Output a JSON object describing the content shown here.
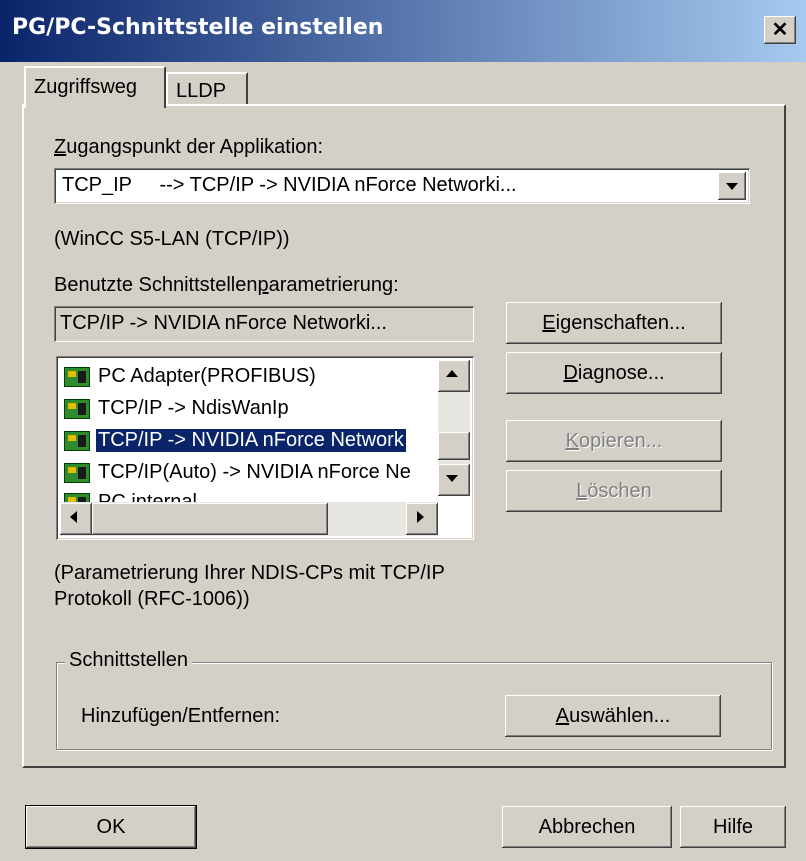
{
  "window": {
    "title": "PG/PC-Schnittstelle einstellen",
    "close_glyph": "✕"
  },
  "tabs": [
    {
      "label": "Zugriffsweg",
      "active": true
    },
    {
      "label": "LLDP",
      "active": false
    }
  ],
  "access_point": {
    "label_first": "Z",
    "label_rest": "ugangspunkt der Applikation:",
    "value": "TCP_IP     --> TCP/IP -> NVIDIA nForce Networki...",
    "description": "(WinCC S5-LAN (TCP/IP))"
  },
  "interface": {
    "label_before": "Benutzte Schnittstellen",
    "label_underlined": "p",
    "label_after": "arametrierung:",
    "current_value": "TCP/IP -> NVIDIA nForce Networki...",
    "list_items": [
      {
        "label": "PC Adapter(PROFIBUS)",
        "selected": false
      },
      {
        "label": "TCP/IP -> NdisWanIp",
        "selected": false
      },
      {
        "label": "TCP/IP -> NVIDIA nForce Network",
        "selected": true
      },
      {
        "label": "TCP/IP(Auto) -> NVIDIA nForce Ne",
        "selected": false
      },
      {
        "label": "PC internal",
        "selected": false
      }
    ],
    "description_line1": "(Parametrierung Ihrer NDIS-CPs mit TCP/IP",
    "description_line2": "Protokoll (RFC-1006))"
  },
  "buttons": {
    "eigenschaften": {
      "u": "E",
      "rest": "igenschaften..."
    },
    "diagnose": {
      "u": "D",
      "rest": "iagnose..."
    },
    "kopieren": {
      "u": "K",
      "rest": "opieren...",
      "disabled": true
    },
    "loeschen": {
      "u": "L",
      "rest": "öschen",
      "disabled": true
    }
  },
  "schnittstellen_group": {
    "legend": "Schnittstellen",
    "label": "Hinzufügen/Entfernen:",
    "button": {
      "u": "A",
      "rest": "uswählen..."
    }
  },
  "footer": {
    "ok": "OK",
    "cancel": "Abbrechen",
    "help": "Hilfe"
  }
}
